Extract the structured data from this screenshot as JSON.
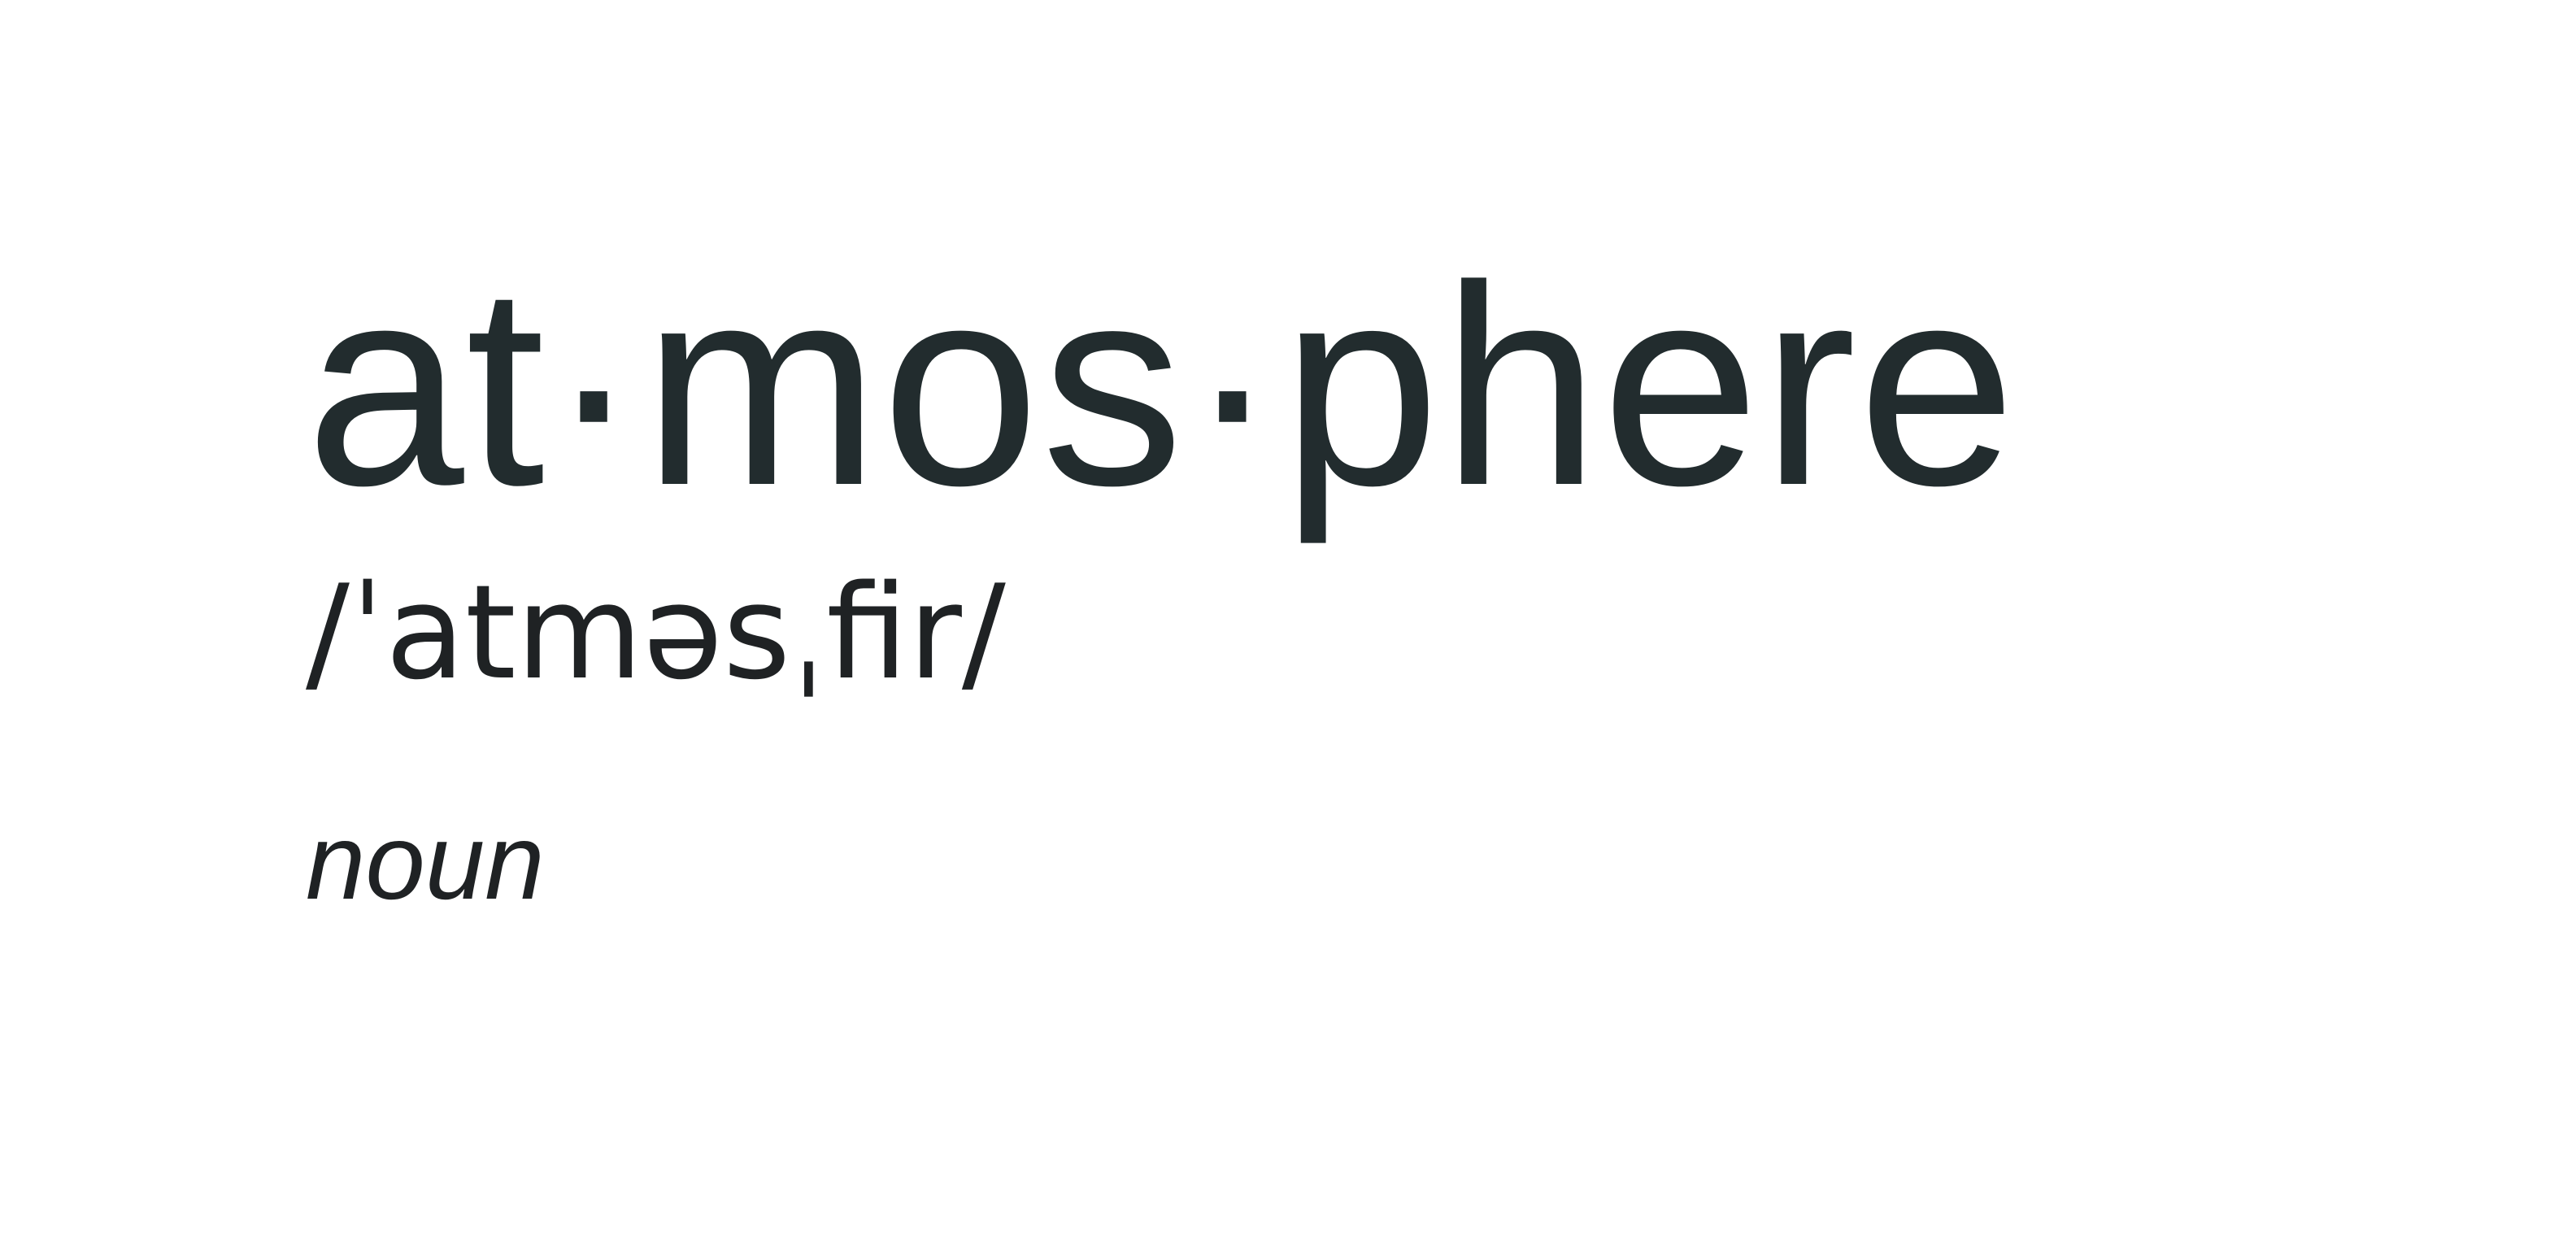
{
  "entry": {
    "headword": "at·mos·phere",
    "pronunciation": "/ˈatməsˌfir/",
    "part_of_speech": "noun"
  },
  "colors": {
    "text_primary": "#222c2e",
    "background": "#ffffff"
  }
}
